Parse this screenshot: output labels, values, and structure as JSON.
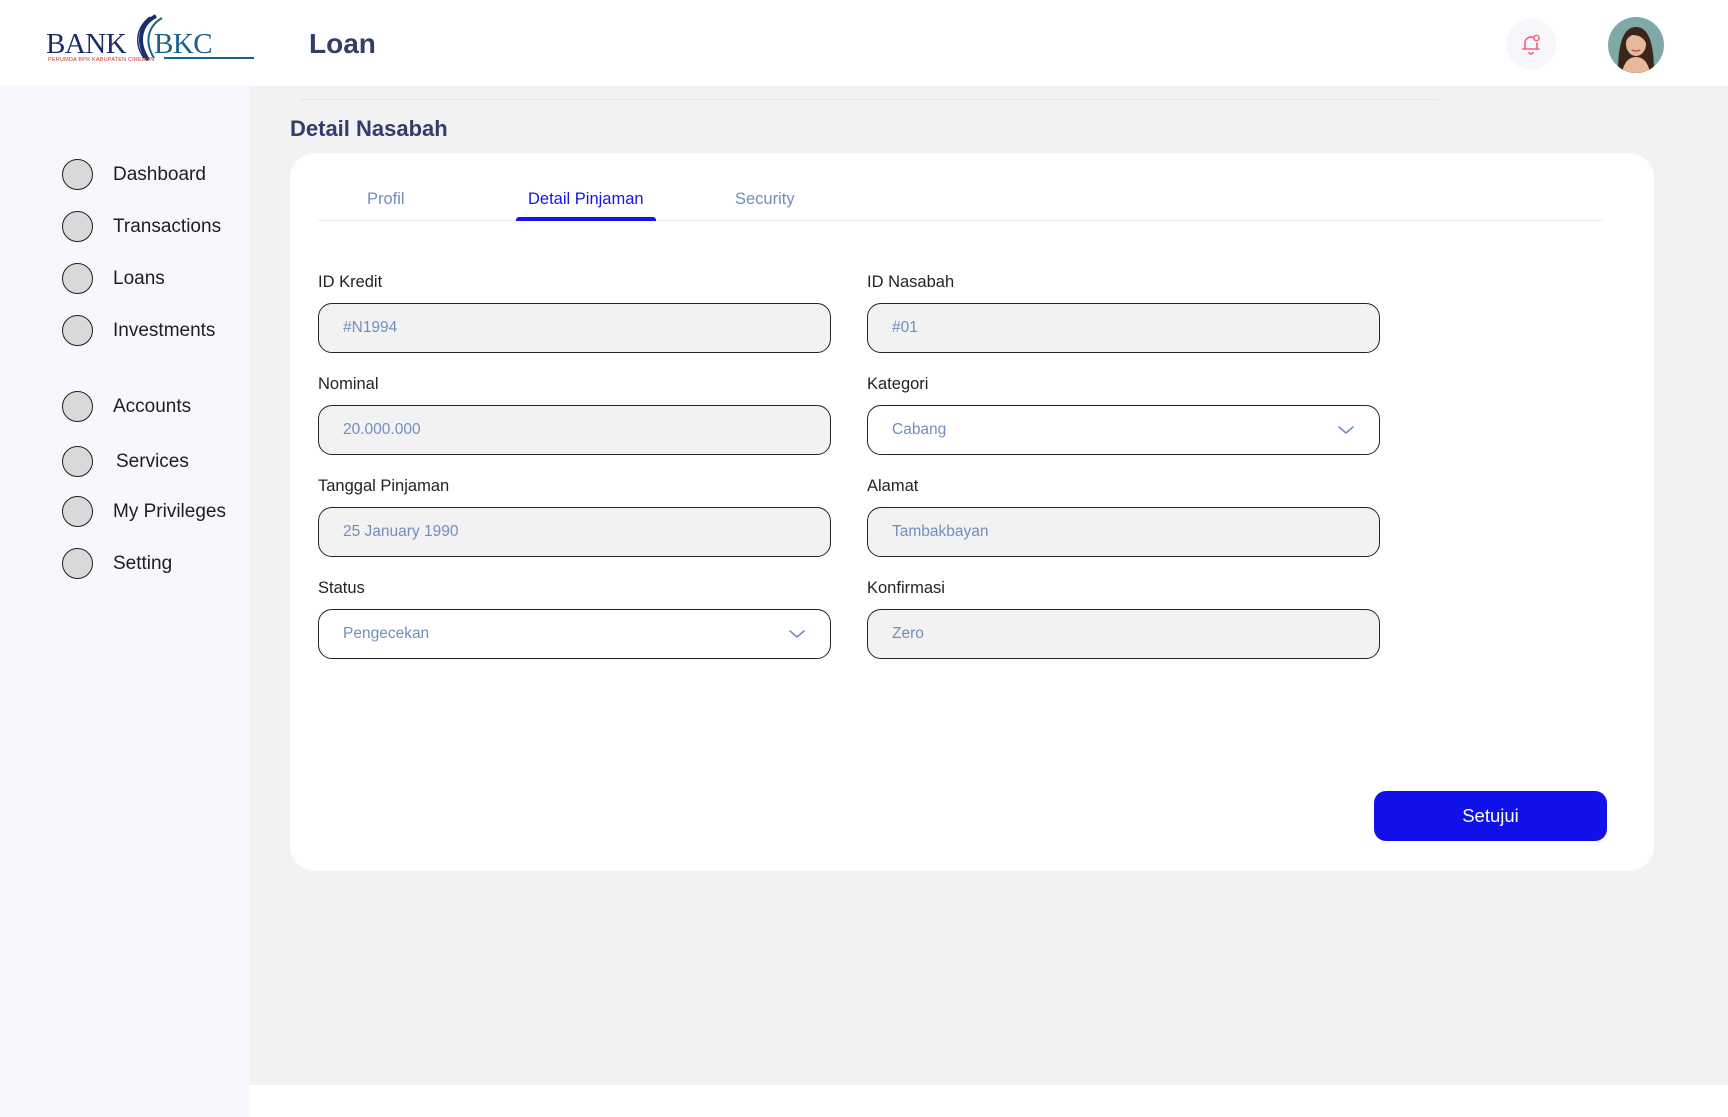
{
  "brand": {
    "name_left": "BANK",
    "name_right": "BKC",
    "tagline": "PERUMDA BPR KABUPATEN CIREBON"
  },
  "header": {
    "title": "Loan"
  },
  "sidebar": {
    "items": [
      {
        "label": "Dashboard"
      },
      {
        "label": "Transactions"
      },
      {
        "label": "Loans"
      },
      {
        "label": "Investments"
      },
      {
        "label": "Accounts"
      },
      {
        "label": "Services"
      },
      {
        "label": "My Privileges"
      },
      {
        "label": "Setting"
      }
    ]
  },
  "main": {
    "section_title": "Detail Nasabah",
    "tabs": [
      {
        "label": "Profil"
      },
      {
        "label": "Detail Pinjaman"
      },
      {
        "label": "Security"
      }
    ],
    "active_tab": "Detail Pinjaman",
    "form": {
      "id_kredit": {
        "label": "ID Kredit",
        "value": "#N1994"
      },
      "id_nasabah": {
        "label": "ID Nasabah",
        "value": "#01"
      },
      "nominal": {
        "label": "Nominal",
        "value": "20.000.000"
      },
      "kategori": {
        "label": "Kategori",
        "value": "Cabang"
      },
      "tanggal_pinjaman": {
        "label": "Tanggal Pinjaman",
        "value": "25 January 1990"
      },
      "alamat": {
        "label": "Alamat",
        "value": "Tambakbayan"
      },
      "status": {
        "label": "Status",
        "value": "Pengecekan"
      },
      "konfirmasi": {
        "label": "Konfirmasi",
        "value": "Zero"
      }
    },
    "approve_label": "Setujui"
  },
  "colors": {
    "accent": "#1814e8",
    "button": "#1010ea",
    "title": "#343c6a",
    "muted": "#718ebf",
    "sidebar_bg": "#f6f8fd",
    "main_bg": "#f2f2f2"
  },
  "icons": {
    "bell": "bell-icon",
    "chevron": "chevron-down-icon"
  }
}
